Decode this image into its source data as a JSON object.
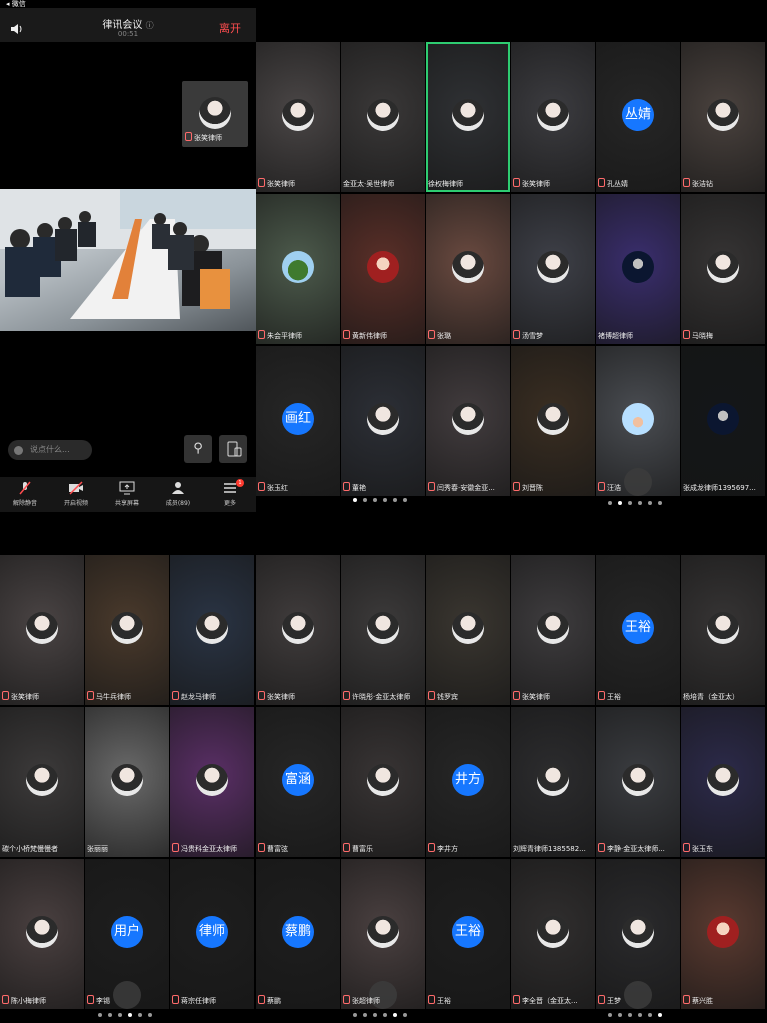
{
  "status_bar": {
    "back": "◂ 微信"
  },
  "header": {
    "title": "律讯会议",
    "timer": "00:51",
    "leave_label": "离开"
  },
  "pip": {
    "name": "张笑律师"
  },
  "chat": {
    "placeholder": "说点什么..."
  },
  "toolbar": {
    "items": [
      {
        "label": "解除静音",
        "icon": "mic-muted-icon"
      },
      {
        "label": "开启视频",
        "icon": "camera-off-icon"
      },
      {
        "label": "共享屏幕",
        "icon": "screen-share-icon"
      },
      {
        "label": "成员(89)",
        "icon": "members-icon"
      },
      {
        "label": "更多",
        "icon": "menu-icon"
      }
    ],
    "badge": "1"
  },
  "grids": {
    "top_left": [
      {
        "name": "张笑律师",
        "av": "photo",
        "bg": "#4a4646",
        "muted": true
      },
      {
        "name": "金亚太·吴世律师",
        "av": "photo",
        "bg": "#3a3838",
        "muted": false
      },
      {
        "name": "徐权梅律师",
        "av": "photo",
        "bg": "#2f3134",
        "muted": false,
        "active": true
      },
      {
        "name": "朱会平律师",
        "av": "green",
        "bg": "#4d5b4c",
        "muted": true
      },
      {
        "name": "黄新伟律师",
        "av": "red",
        "bg": "#5a2f28",
        "muted": true
      },
      {
        "name": "张璐",
        "av": "photo",
        "bg": "#6a4a40",
        "muted": true
      },
      {
        "name": "张玉红",
        "av": "text",
        "avText": "画红",
        "bg": "#262626",
        "muted": true
      },
      {
        "name": "董艳",
        "av": "photo",
        "bg": "#2c2f36",
        "muted": true
      },
      {
        "name": "闫秀春·安徽金亚...",
        "av": "photo",
        "bg": "#423c3e",
        "muted": true
      }
    ],
    "top_right": [
      {
        "name": "张笑律师",
        "av": "photo",
        "bg": "#3c3c40",
        "muted": true
      },
      {
        "name": "孔丛婧",
        "av": "text",
        "avText": "丛婧",
        "bg": "#262626",
        "muted": true
      },
      {
        "name": "张洁钻",
        "av": "photo",
        "bg": "#4a423e",
        "muted": true
      },
      {
        "name": "汤雪梦",
        "av": "photo",
        "bg": "#3e4048",
        "muted": true
      },
      {
        "name": "褚博超律师",
        "av": "dark",
        "bg": "#3a2e6e",
        "muted": false
      },
      {
        "name": "马晓梅",
        "av": "photo",
        "bg": "#363434",
        "muted": true
      },
      {
        "name": "刘晋陈",
        "av": "photo",
        "bg": "#3a2e22",
        "muted": true
      },
      {
        "name": "汪浩",
        "av": "sky",
        "bg": "#4a4d52",
        "muted": true,
        "speaking": true
      },
      {
        "name": "张成龙律师1395697...",
        "av": "dark",
        "bg": "#141618",
        "muted": false
      }
    ],
    "bottom_left": [
      {
        "name": "张笑律师",
        "av": "photo",
        "bg": "#4a4444",
        "muted": true
      },
      {
        "name": "马牛兵律师",
        "av": "photo",
        "bg": "#4a3a2c",
        "muted": true
      },
      {
        "name": "赵龙马律师",
        "av": "photo",
        "bg": "#2a3444",
        "muted": true
      },
      {
        "name": "碳个小桥梵慢慢者",
        "av": "photo",
        "bg": "#3c3a3a",
        "muted": false
      },
      {
        "name": "张丽丽",
        "av": "photo",
        "bg": "#6a6a6a",
        "muted": false
      },
      {
        "name": "冯贵科金亚太律师",
        "av": "photo",
        "bg": "#5a2f66",
        "muted": true
      },
      {
        "name": "陈小梅律师",
        "av": "photo",
        "bg": "#4a4040",
        "muted": true
      },
      {
        "name": "李锡",
        "av": "text",
        "avText": "用户",
        "bg": "#1e1e1e",
        "muted": true,
        "speaking": true
      },
      {
        "name": "蒋宗任律师",
        "av": "text",
        "avText": "律师",
        "bg": "#1e1e1e",
        "muted": true
      }
    ],
    "bottom_middle": [
      {
        "name": "张笑律师",
        "av": "photo",
        "bg": "#403c3c",
        "muted": true
      },
      {
        "name": "许晓彤·金亚太律师",
        "av": "photo",
        "bg": "#3c3a3a",
        "muted": true
      },
      {
        "name": "钱罗宾",
        "av": "photo",
        "bg": "#3a3630",
        "muted": true
      },
      {
        "name": "曹富弦",
        "av": "text",
        "avText": "富涵",
        "bg": "#262626",
        "muted": true
      },
      {
        "name": "曹富乐",
        "av": "photo",
        "bg": "#383434",
        "muted": true
      },
      {
        "name": "李井方",
        "av": "text",
        "avText": "井方",
        "bg": "#262626",
        "muted": true
      },
      {
        "name": "蔡鹏",
        "av": "text",
        "avText": "蔡鹏",
        "bg": "#1e1e1e",
        "muted": true
      },
      {
        "name": "张超律师",
        "av": "photo",
        "bg": "#4a4040",
        "muted": true,
        "speaking": true
      },
      {
        "name": "王裕",
        "av": "text",
        "avText": "王裕",
        "bg": "#1e1e1e",
        "muted": true
      }
    ],
    "bottom_right": [
      {
        "name": "张笑律师",
        "av": "photo",
        "bg": "#3e3c3e",
        "muted": true
      },
      {
        "name": "王裕",
        "av": "text",
        "avText": "王裕",
        "bg": "#262626",
        "muted": true
      },
      {
        "name": "杨培青（金亚太）",
        "av": "photo",
        "bg": "#363434",
        "muted": false
      },
      {
        "name": "刘辉青律师1385582...",
        "av": "photo",
        "bg": "#2c2c2e",
        "muted": false
      },
      {
        "name": "李静·金亚太律师...",
        "av": "photo",
        "bg": "#3a3c40",
        "muted": true
      },
      {
        "name": "张玉东",
        "av": "photo",
        "bg": "#2c2a4a",
        "muted": true
      },
      {
        "name": "李全晋（金亚太...",
        "av": "photo",
        "bg": "#302e2e",
        "muted": true
      },
      {
        "name": "王梦",
        "av": "photo",
        "bg": "#2a2a2c",
        "muted": true,
        "speaking": true
      },
      {
        "name": "蔡兴胜",
        "av": "red",
        "bg": "#5a3a30",
        "muted": true
      }
    ]
  },
  "pagers": {
    "top_left": {
      "count": 6,
      "active": 0
    },
    "top_right": {
      "count": 6,
      "active": 1
    },
    "bottom_left": {
      "count": 6,
      "active": 3
    },
    "bottom_middle": {
      "count": 6,
      "active": 4
    },
    "bottom_right": {
      "count": 6,
      "active": 5
    }
  }
}
